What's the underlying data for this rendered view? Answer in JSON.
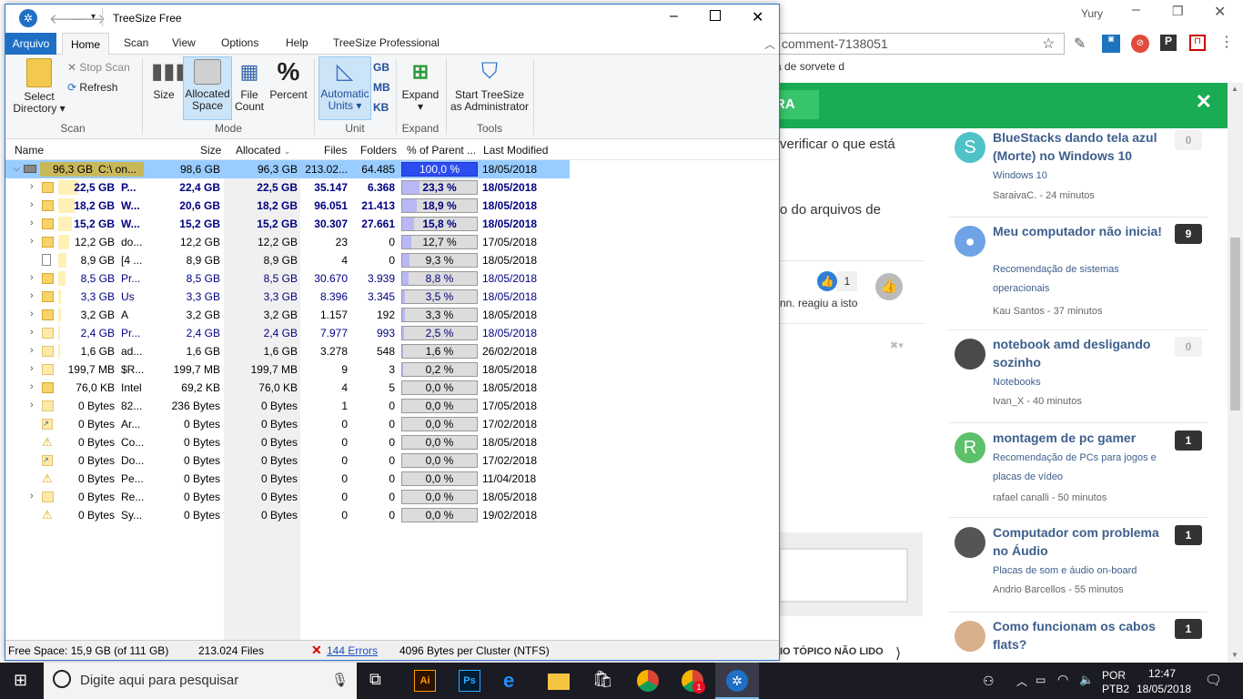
{
  "browser": {
    "user_name": "Yury",
    "address": "comment-7138051",
    "bookmark": "ita de sorvete d",
    "banner_button": "RA",
    "post_text_1": "verificar o que está",
    "post_text_2": "o do arquivos de",
    "like_count": "1",
    "reacted_text": "nn. reagiu a isto",
    "unread_label": "IO TÓPICO NÃO LIDO",
    "topics": [
      {
        "avatar": "S",
        "avatar_color": "#4fc1c8",
        "title": "BlueStacks dando tela azul (Morte) no Windows 10",
        "category": "Windows 10",
        "meta": "SaraivaC. - 24 minutos",
        "count": "0"
      },
      {
        "avatar": "",
        "avatar_color": "#6ea3e6",
        "title": "Meu computador não inicia!",
        "category": "Recomendação de sistemas operacionais",
        "meta": "Kau Santos - 37 minutos",
        "count": "9"
      },
      {
        "avatar": "",
        "avatar_color": "#4a4a4a",
        "title": "notebook amd desligando sozinho",
        "category": "Notebooks",
        "meta": "Ivan_X - 40 minutos",
        "count": "0"
      },
      {
        "avatar": "R",
        "avatar_color": "#5cc16a",
        "title": "montagem de pc gamer",
        "category": "Recomendação de PCs para jogos e placas de vídeo",
        "meta": "rafael canalli - 50 minutos",
        "count": "1"
      },
      {
        "avatar": "",
        "avatar_color": "#555555",
        "title": "Computador com problema no Áudio",
        "category": "Placas de som e áudio on-board",
        "meta": "Andrio Barcellos - 55 minutos",
        "count": "1"
      },
      {
        "avatar": "",
        "avatar_color": "#d9b08c",
        "title": "Como funcionam os cabos flats?",
        "category": "",
        "meta": "",
        "count": "1"
      }
    ]
  },
  "window": {
    "title": "TreeSize Free",
    "tabs": {
      "file": "Arquivo",
      "home": "Home",
      "scan": "Scan",
      "view": "View",
      "options": "Options",
      "help": "Help",
      "pro": "TreeSize Professional"
    },
    "ribbon": {
      "select_directory": "Select Directory",
      "stop_scan": "Stop Scan",
      "refresh": "Refresh",
      "group_scan": "Scan",
      "size": "Size",
      "allocated_space": "Allocated Space",
      "file_count": "File Count",
      "percent": "Percent",
      "group_mode": "Mode",
      "automatic_units": "Automatic Units",
      "gb": "GB",
      "mb": "MB",
      "kb": "KB",
      "group_unit": "Unit",
      "expand": "Expand",
      "group_expand": "Expand",
      "start_admin": "Start TreeSize as Administrator",
      "group_tools": "Tools"
    },
    "columns": {
      "name": "Name",
      "size": "Size",
      "allocated": "Allocated",
      "files": "Files",
      "folders": "Folders",
      "percent": "% of Parent ...",
      "modified": "Last Modified"
    },
    "rows": [
      {
        "alloc_label": "96,3 GB",
        "name": "C:\\  on...",
        "size": "98,6 GB",
        "allocated": "96,3 GB",
        "files": "213.02...",
        "folders": "64.485",
        "percent": "100,0 %",
        "pct": 100,
        "modified": "18/05/2018",
        "style": "top",
        "icon": "drive"
      },
      {
        "alloc_label": "22,5 GB",
        "name": "P...",
        "size": "22,4 GB",
        "allocated": "22,5 GB",
        "files": "35.147",
        "folders": "6.368",
        "percent": "23,3 %",
        "pct": 23.3,
        "modified": "18/05/2018",
        "style": "bold",
        "icon": "folder"
      },
      {
        "alloc_label": "18,2 GB",
        "name": "W...",
        "size": "20,6 GB",
        "allocated": "18,2 GB",
        "files": "96.051",
        "folders": "21.413",
        "percent": "18,9 %",
        "pct": 18.9,
        "modified": "18/05/2018",
        "style": "bold",
        "icon": "folder"
      },
      {
        "alloc_label": "15,2 GB",
        "name": "W...",
        "size": "15,2 GB",
        "allocated": "15,2 GB",
        "files": "30.307",
        "folders": "27.661",
        "percent": "15,8 %",
        "pct": 15.8,
        "modified": "18/05/2018",
        "style": "bold",
        "icon": "folder"
      },
      {
        "alloc_label": "12,2 GB",
        "name": "do...",
        "size": "12,2 GB",
        "allocated": "12,2 GB",
        "files": "23",
        "folders": "0",
        "percent": "12,7 %",
        "pct": 12.7,
        "modified": "17/05/2018",
        "style": "",
        "icon": "folder"
      },
      {
        "alloc_label": "8,9 GB",
        "name": "[4 ...",
        "size": "8,9 GB",
        "allocated": "8,9 GB",
        "files": "4",
        "folders": "0",
        "percent": "9,3 %",
        "pct": 9.3,
        "modified": "18/05/2018",
        "style": "",
        "icon": "file"
      },
      {
        "alloc_label": "8,5 GB",
        "name": "Pr...",
        "size": "8,5 GB",
        "allocated": "8,5 GB",
        "files": "30.670",
        "folders": "3.939",
        "percent": "8,8 %",
        "pct": 8.8,
        "modified": "18/05/2018",
        "style": "blue",
        "icon": "folder"
      },
      {
        "alloc_label": "3,3 GB",
        "name": "Us",
        "size": "3,3 GB",
        "allocated": "3,3 GB",
        "files": "8.396",
        "folders": "3.345",
        "percent": "3,5 %",
        "pct": 3.5,
        "modified": "18/05/2018",
        "style": "blue",
        "icon": "folder"
      },
      {
        "alloc_label": "3,2 GB",
        "name": "A",
        "size": "3,2 GB",
        "allocated": "3,2 GB",
        "files": "1.157",
        "folders": "192",
        "percent": "3,3 %",
        "pct": 3.3,
        "modified": "18/05/2018",
        "style": "",
        "icon": "folder"
      },
      {
        "alloc_label": "2,4 GB",
        "name": "Pr...",
        "size": "2,4 GB",
        "allocated": "2,4 GB",
        "files": "7.977",
        "folders": "993",
        "percent": "2,5 %",
        "pct": 2.5,
        "modified": "18/05/2018",
        "style": "blue",
        "icon": "folder-light"
      },
      {
        "alloc_label": "1,6 GB",
        "name": "ad...",
        "size": "1,6 GB",
        "allocated": "1,6 GB",
        "files": "3.278",
        "folders": "548",
        "percent": "1,6 %",
        "pct": 1.6,
        "modified": "26/02/2018",
        "style": "",
        "icon": "folder-light"
      },
      {
        "alloc_label": "199,7 MB",
        "name": "$R...",
        "size": "199,7 MB",
        "allocated": "199,7 MB",
        "files": "9",
        "folders": "3",
        "percent": "0,2 %",
        "pct": 0.2,
        "modified": "18/05/2018",
        "style": "",
        "icon": "folder-light"
      },
      {
        "alloc_label": "76,0 KB",
        "name": "Intel",
        "size": "69,2 KB",
        "allocated": "76,0 KB",
        "files": "4",
        "folders": "5",
        "percent": "0,0 %",
        "pct": 0,
        "modified": "18/05/2018",
        "style": "",
        "icon": "folder"
      },
      {
        "alloc_label": "0 Bytes",
        "name": "82...",
        "size": "236 Bytes",
        "allocated": "0 Bytes",
        "files": "1",
        "folders": "0",
        "percent": "0,0 %",
        "pct": 0,
        "modified": "17/05/2018",
        "style": "",
        "icon": "folder-light"
      },
      {
        "alloc_label": "0 Bytes",
        "name": "Ar...",
        "size": "0 Bytes",
        "allocated": "0 Bytes",
        "files": "0",
        "folders": "0",
        "percent": "0,0 %",
        "pct": 0,
        "modified": "17/02/2018",
        "style": "",
        "icon": "shortcut"
      },
      {
        "alloc_label": "0 Bytes",
        "name": "Co...",
        "size": "0 Bytes",
        "allocated": "0 Bytes",
        "files": "0",
        "folders": "0",
        "percent": "0,0 %",
        "pct": 0,
        "modified": "18/05/2018",
        "style": "",
        "icon": "warning"
      },
      {
        "alloc_label": "0 Bytes",
        "name": "Do...",
        "size": "0 Bytes",
        "allocated": "0 Bytes",
        "files": "0",
        "folders": "0",
        "percent": "0,0 %",
        "pct": 0,
        "modified": "17/02/2018",
        "style": "",
        "icon": "shortcut"
      },
      {
        "alloc_label": "0 Bytes",
        "name": "Pe...",
        "size": "0 Bytes",
        "allocated": "0 Bytes",
        "files": "0",
        "folders": "0",
        "percent": "0,0 %",
        "pct": 0,
        "modified": "11/04/2018",
        "style": "",
        "icon": "warning"
      },
      {
        "alloc_label": "0 Bytes",
        "name": "Re...",
        "size": "0 Bytes",
        "allocated": "0 Bytes",
        "files": "0",
        "folders": "0",
        "percent": "0,0 %",
        "pct": 0,
        "modified": "18/05/2018",
        "style": "",
        "icon": "folder-light"
      },
      {
        "alloc_label": "0 Bytes",
        "name": "Sy...",
        "size": "0 Bytes",
        "allocated": "0 Bytes",
        "files": "0",
        "folders": "0",
        "percent": "0,0 %",
        "pct": 0,
        "modified": "19/02/2018",
        "style": "",
        "icon": "warning"
      }
    ],
    "status": {
      "free_space": "Free Space: 15,9 GB  (of 111 GB)",
      "files": "213.024  Files",
      "errors": "144 Errors",
      "cluster": "4096  Bytes per Cluster (NTFS)"
    }
  },
  "taskbar": {
    "search_placeholder": "Digite aqui para pesquisar",
    "lang_1": "POR",
    "lang_2": "PTB2",
    "time": "12:47",
    "date": "18/05/2018",
    "chrome_badge": "1"
  }
}
